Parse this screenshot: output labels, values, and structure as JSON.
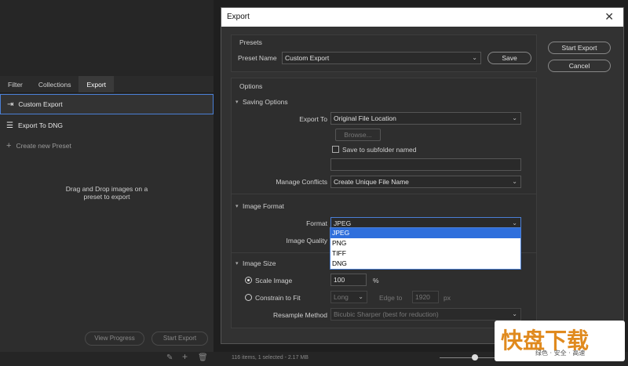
{
  "left": {
    "tabs": [
      {
        "label": "Filter"
      },
      {
        "label": "Collections"
      },
      {
        "label": "Export"
      }
    ],
    "presets": [
      {
        "label": "Custom Export",
        "icon": "export-icon"
      },
      {
        "label": "Export To DNG",
        "icon": "list-icon"
      }
    ],
    "create_label": "Create new Preset",
    "drag_line1": "Drag and Drop images on a",
    "drag_line2": "preset to export",
    "view_progress": "View Progress",
    "start_export": "Start Export"
  },
  "status": {
    "text": "116 items, 1 selected - 2.17 MB"
  },
  "dialog": {
    "title": "Export",
    "start_export": "Start Export",
    "cancel": "Cancel",
    "presets": {
      "heading": "Presets",
      "preset_name_label": "Preset Name",
      "preset_name_value": "Custom Export",
      "save": "Save"
    },
    "options": {
      "heading": "Options",
      "saving": {
        "heading": "Saving Options",
        "export_to_label": "Export To",
        "export_to_value": "Original File Location",
        "browse": "Browse...",
        "subfolder_label": "Save to subfolder named",
        "subfolder_value": "",
        "conflicts_label": "Manage Conflicts",
        "conflicts_value": "Create Unique File Name"
      },
      "format": {
        "heading": "Image Format",
        "format_label": "Format",
        "format_value": "JPEG",
        "quality_label": "Image Quality",
        "options": [
          "JPEG",
          "PNG",
          "TIFF",
          "DNG"
        ]
      },
      "size": {
        "heading": "Image Size",
        "scale_label": "Scale Image",
        "scale_value": "100",
        "scale_unit": "%",
        "constrain_label": "Constrain to Fit",
        "constrain_side": "Long",
        "edge_to": "Edge to",
        "edge_value": "1920",
        "edge_unit": "px",
        "resample_label": "Resample Method",
        "resample_value": "Bicubic Sharper (best for reduction)"
      }
    }
  },
  "watermark": {
    "main": "快盘下载",
    "sub": "绿色 · 安全 · 高速"
  }
}
